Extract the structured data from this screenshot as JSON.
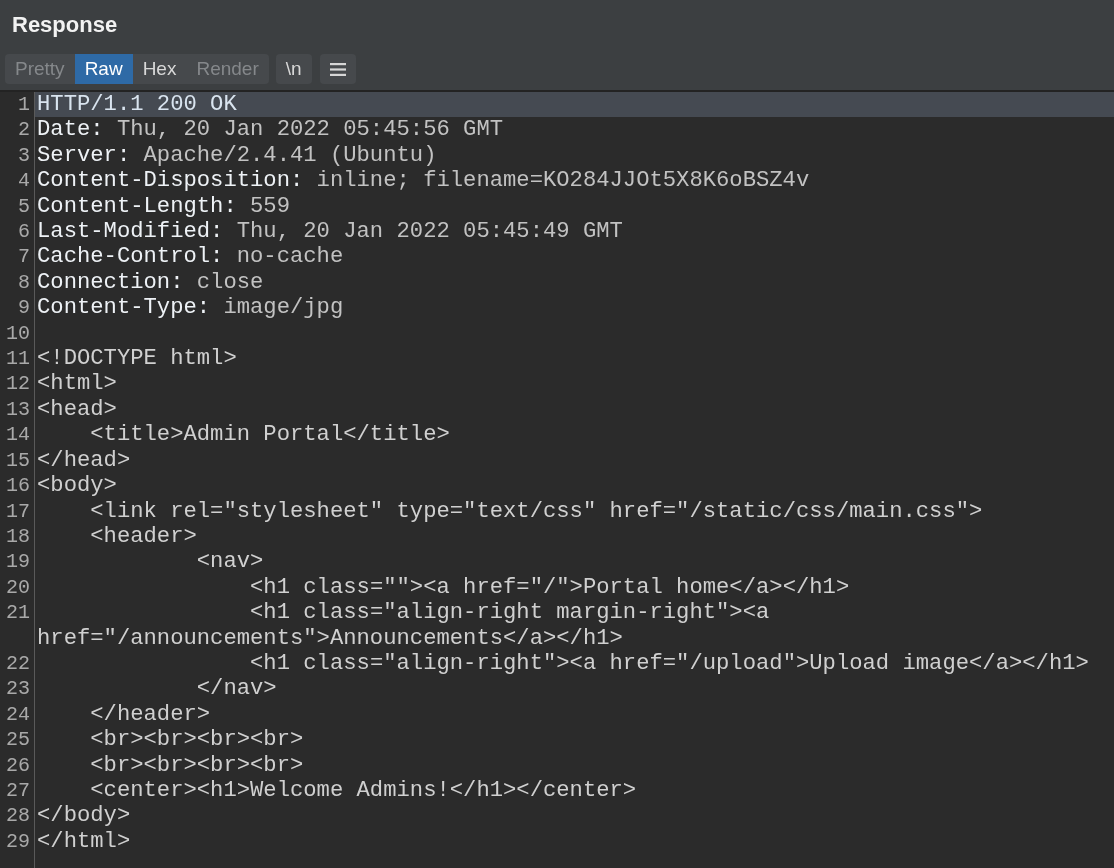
{
  "panel": {
    "title": "Response"
  },
  "view_tabs": [
    {
      "label": "Pretty",
      "selected": false,
      "disabled": true
    },
    {
      "label": "Raw",
      "selected": true,
      "disabled": false
    },
    {
      "label": "Hex",
      "selected": false,
      "disabled": false
    },
    {
      "label": "Render",
      "selected": false,
      "disabled": true
    }
  ],
  "toolbar": {
    "newline_button": "\\n"
  },
  "editor": {
    "lines": [
      {
        "number": "1",
        "kind": "status",
        "text": "HTTP/1.1 200 OK",
        "selected": true
      },
      {
        "number": "2",
        "kind": "header",
        "name": "Date:",
        "value": "Thu, 20 Jan 2022 05:45:56 GMT",
        "selected": false
      },
      {
        "number": "3",
        "kind": "header",
        "name": "Server:",
        "value": "Apache/2.4.41 (Ubuntu)",
        "selected": false
      },
      {
        "number": "4",
        "kind": "header",
        "name": "Content-Disposition:",
        "value": "inline; filename=KO284JJOt5X8K6oBSZ4v",
        "selected": false
      },
      {
        "number": "5",
        "kind": "header",
        "name": "Content-Length:",
        "value": "559",
        "selected": false
      },
      {
        "number": "6",
        "kind": "header",
        "name": "Last-Modified:",
        "value": "Thu, 20 Jan 2022 05:45:49 GMT",
        "selected": false
      },
      {
        "number": "7",
        "kind": "header",
        "name": "Cache-Control:",
        "value": "no-cache",
        "selected": false
      },
      {
        "number": "8",
        "kind": "header",
        "name": "Connection:",
        "value": "close",
        "selected": false
      },
      {
        "number": "9",
        "kind": "header",
        "name": "Content-Type:",
        "value": "image/jpg",
        "selected": false
      },
      {
        "number": "10",
        "kind": "blank",
        "selected": false
      },
      {
        "number": "11",
        "kind": "markup",
        "text": "<!DOCTYPE html>",
        "selected": false
      },
      {
        "number": "12",
        "kind": "markup",
        "text": "<html>",
        "selected": false
      },
      {
        "number": "13",
        "kind": "markup",
        "text": "<head>",
        "selected": false
      },
      {
        "number": "14",
        "kind": "markup",
        "text": "    <title>Admin Portal</title>",
        "selected": false
      },
      {
        "number": "15",
        "kind": "markup",
        "text": "</head>",
        "selected": false
      },
      {
        "number": "16",
        "kind": "markup",
        "text": "<body>",
        "selected": false
      },
      {
        "number": "17",
        "kind": "markup",
        "text": "    <link rel=\"stylesheet\" type=\"text/css\" href=\"/static/css/main.css\">",
        "selected": false
      },
      {
        "number": "18",
        "kind": "markup",
        "text": "    <header>",
        "selected": false
      },
      {
        "number": "19",
        "kind": "markup",
        "text": "            <nav>",
        "selected": false
      },
      {
        "number": "20",
        "kind": "markup",
        "text": "                <h1 class=\"\"><a href=\"/\">Portal home</a></h1>",
        "selected": false
      },
      {
        "number": "21",
        "kind": "markup",
        "text": "                <h1 class=\"align-right margin-right\"><a href=\"/announcements\">Announcements</a></h1>",
        "selected": false
      },
      {
        "number": "22",
        "kind": "markup",
        "text": "                <h1 class=\"align-right\"><a href=\"/upload\">Upload image</a></h1>",
        "selected": false
      },
      {
        "number": "23",
        "kind": "markup",
        "text": "            </nav>",
        "selected": false
      },
      {
        "number": "24",
        "kind": "markup",
        "text": "    </header>",
        "selected": false
      },
      {
        "number": "25",
        "kind": "markup",
        "text": "    <br><br><br><br>",
        "selected": false
      },
      {
        "number": "26",
        "kind": "markup",
        "text": "    <br><br><br><br>",
        "selected": false
      },
      {
        "number": "27",
        "kind": "markup",
        "text": "    <center><h1>Welcome Admins!</h1></center>",
        "selected": false
      },
      {
        "number": "28",
        "kind": "markup",
        "text": "</body>",
        "selected": false
      },
      {
        "number": "29",
        "kind": "markup",
        "text": "</html>",
        "selected": false
      }
    ]
  }
}
